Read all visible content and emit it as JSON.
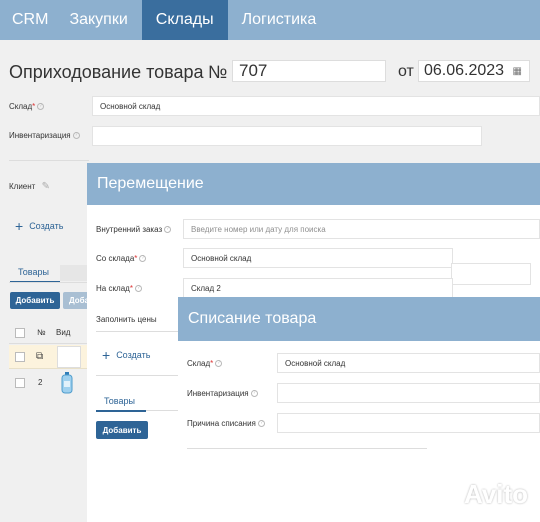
{
  "nav": {
    "items": [
      {
        "label": "CRM"
      },
      {
        "label": "Закупки"
      },
      {
        "label": "Склады"
      },
      {
        "label": "Логистика"
      }
    ],
    "active_index": 2
  },
  "page": {
    "title": "Оприходование товара",
    "number_sign": "№",
    "number": "707",
    "date_prefix": "от",
    "date": "06.06.2023"
  },
  "form": {
    "warehouse_label": "Склад",
    "warehouse_value": "Основной склад",
    "inventory_label": "Инвентаризация",
    "inventory_value": "",
    "client_label": "Клиент",
    "create_label": "Создать"
  },
  "goods": {
    "tab": "Товары",
    "add_button": "Добавить",
    "add_button_2": "Доба",
    "columns": {
      "num": "№",
      "view": "Вид"
    },
    "rows": [
      {
        "num": "2"
      }
    ]
  },
  "transfer_dialog": {
    "title": "Перемещение",
    "internal_order_label": "Внутренний заказ",
    "internal_order_placeholder": "Введите номер или дату для поиска",
    "from_label": "Со склада",
    "from_value": "Основной склад",
    "to_label": "На склад",
    "to_value": "Склад 2",
    "fill_prices_label": "Заполнить цены",
    "create_label": "Создать",
    "tab": "Товары",
    "add_button": "Добавить"
  },
  "writeoff_dialog": {
    "title": "Списание товара",
    "warehouse_label": "Склад",
    "warehouse_value": "Основной склад",
    "inventory_label": "Инвентаризация",
    "reason_label": "Причина списания"
  },
  "watermark": {
    "text": "Avito"
  },
  "colors": {
    "nav": "#8db0cf",
    "nav_active": "#3a6e9e",
    "button": "#2e6496",
    "required": "#dd3333"
  }
}
